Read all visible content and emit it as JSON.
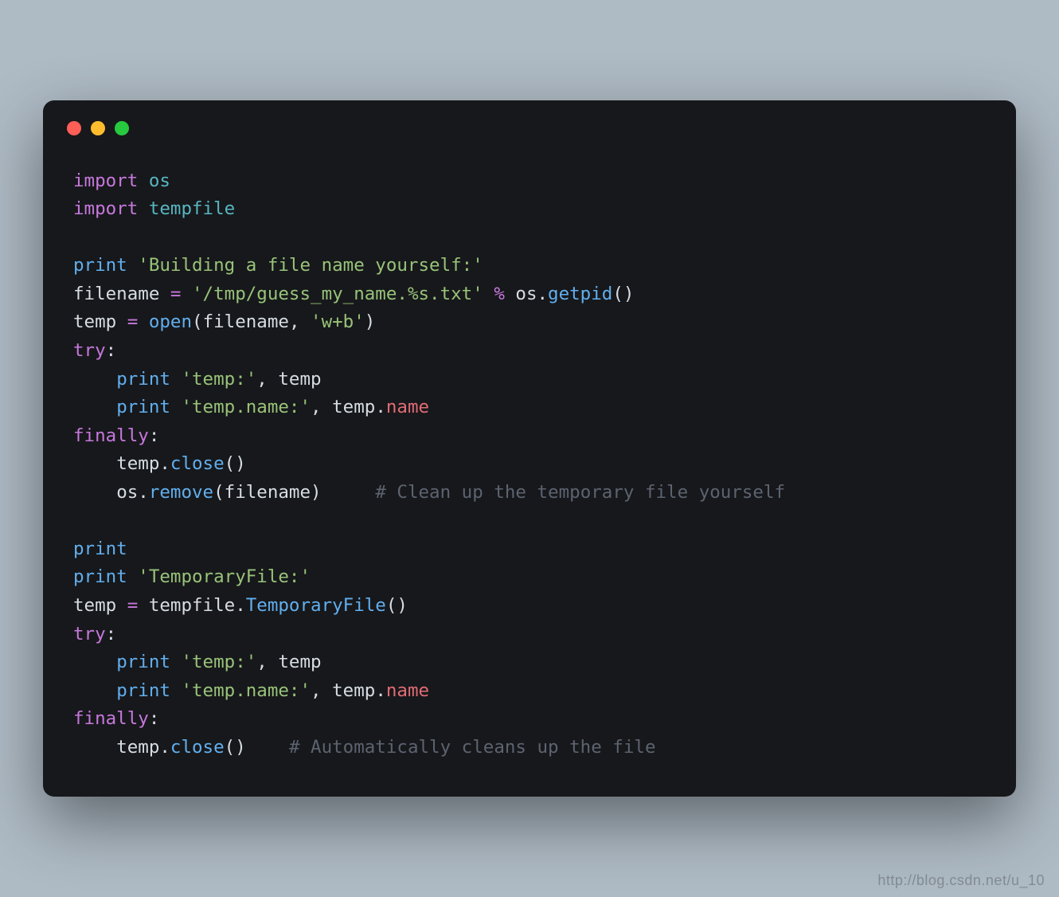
{
  "watermark": "http://blog.csdn.net/u_10",
  "tokens": [
    [
      [
        "kw",
        "import"
      ],
      [
        "pun",
        " "
      ],
      [
        "nm",
        "os"
      ]
    ],
    [
      [
        "kw",
        "import"
      ],
      [
        "pun",
        " "
      ],
      [
        "nm",
        "tempfile"
      ]
    ],
    [],
    [
      [
        "fn",
        "print"
      ],
      [
        "pun",
        " "
      ],
      [
        "str",
        "'Building a file name yourself:'"
      ]
    ],
    [
      [
        "id",
        "filename"
      ],
      [
        "pun",
        " "
      ],
      [
        "eq",
        "="
      ],
      [
        "pun",
        " "
      ],
      [
        "str",
        "'/tmp/guess_my_name.%s.txt'"
      ],
      [
        "pun",
        " "
      ],
      [
        "op",
        "%"
      ],
      [
        "pun",
        " "
      ],
      [
        "id",
        "os"
      ],
      [
        "pun",
        "."
      ],
      [
        "fn",
        "getpid"
      ],
      [
        "pun",
        "()"
      ]
    ],
    [
      [
        "id",
        "temp"
      ],
      [
        "pun",
        " "
      ],
      [
        "eq",
        "="
      ],
      [
        "pun",
        " "
      ],
      [
        "fn",
        "open"
      ],
      [
        "pun",
        "("
      ],
      [
        "id",
        "filename"
      ],
      [
        "pun",
        ", "
      ],
      [
        "str",
        "'w+b'"
      ],
      [
        "pun",
        ")"
      ]
    ],
    [
      [
        "kw",
        "try"
      ],
      [
        "pun",
        ":"
      ]
    ],
    [
      [
        "pun",
        "    "
      ],
      [
        "fn",
        "print"
      ],
      [
        "pun",
        " "
      ],
      [
        "str",
        "'temp:'"
      ],
      [
        "pun",
        ", "
      ],
      [
        "id",
        "temp"
      ]
    ],
    [
      [
        "pun",
        "    "
      ],
      [
        "fn",
        "print"
      ],
      [
        "pun",
        " "
      ],
      [
        "str",
        "'temp.name:'"
      ],
      [
        "pun",
        ", "
      ],
      [
        "id",
        "temp"
      ],
      [
        "pun",
        "."
      ],
      [
        "attr",
        "name"
      ]
    ],
    [
      [
        "kw",
        "finally"
      ],
      [
        "pun",
        ":"
      ]
    ],
    [
      [
        "pun",
        "    "
      ],
      [
        "id",
        "temp"
      ],
      [
        "pun",
        "."
      ],
      [
        "fn",
        "close"
      ],
      [
        "pun",
        "()"
      ]
    ],
    [
      [
        "pun",
        "    "
      ],
      [
        "id",
        "os"
      ],
      [
        "pun",
        "."
      ],
      [
        "fn",
        "remove"
      ],
      [
        "pun",
        "("
      ],
      [
        "id",
        "filename"
      ],
      [
        "pun",
        ")     "
      ],
      [
        "cm",
        "# Clean up the temporary file yourself"
      ]
    ],
    [],
    [
      [
        "fn",
        "print"
      ]
    ],
    [
      [
        "fn",
        "print"
      ],
      [
        "pun",
        " "
      ],
      [
        "str",
        "'TemporaryFile:'"
      ]
    ],
    [
      [
        "id",
        "temp"
      ],
      [
        "pun",
        " "
      ],
      [
        "eq",
        "="
      ],
      [
        "pun",
        " "
      ],
      [
        "id",
        "tempfile"
      ],
      [
        "pun",
        "."
      ],
      [
        "fn",
        "TemporaryFile"
      ],
      [
        "pun",
        "()"
      ]
    ],
    [
      [
        "kw",
        "try"
      ],
      [
        "pun",
        ":"
      ]
    ],
    [
      [
        "pun",
        "    "
      ],
      [
        "fn",
        "print"
      ],
      [
        "pun",
        " "
      ],
      [
        "str",
        "'temp:'"
      ],
      [
        "pun",
        ", "
      ],
      [
        "id",
        "temp"
      ]
    ],
    [
      [
        "pun",
        "    "
      ],
      [
        "fn",
        "print"
      ],
      [
        "pun",
        " "
      ],
      [
        "str",
        "'temp.name:'"
      ],
      [
        "pun",
        ", "
      ],
      [
        "id",
        "temp"
      ],
      [
        "pun",
        "."
      ],
      [
        "attr",
        "name"
      ]
    ],
    [
      [
        "kw",
        "finally"
      ],
      [
        "pun",
        ":"
      ]
    ],
    [
      [
        "pun",
        "    "
      ],
      [
        "id",
        "temp"
      ],
      [
        "pun",
        "."
      ],
      [
        "fn",
        "close"
      ],
      [
        "pun",
        "()    "
      ],
      [
        "cm",
        "# Automatically cleans up the file"
      ]
    ]
  ]
}
